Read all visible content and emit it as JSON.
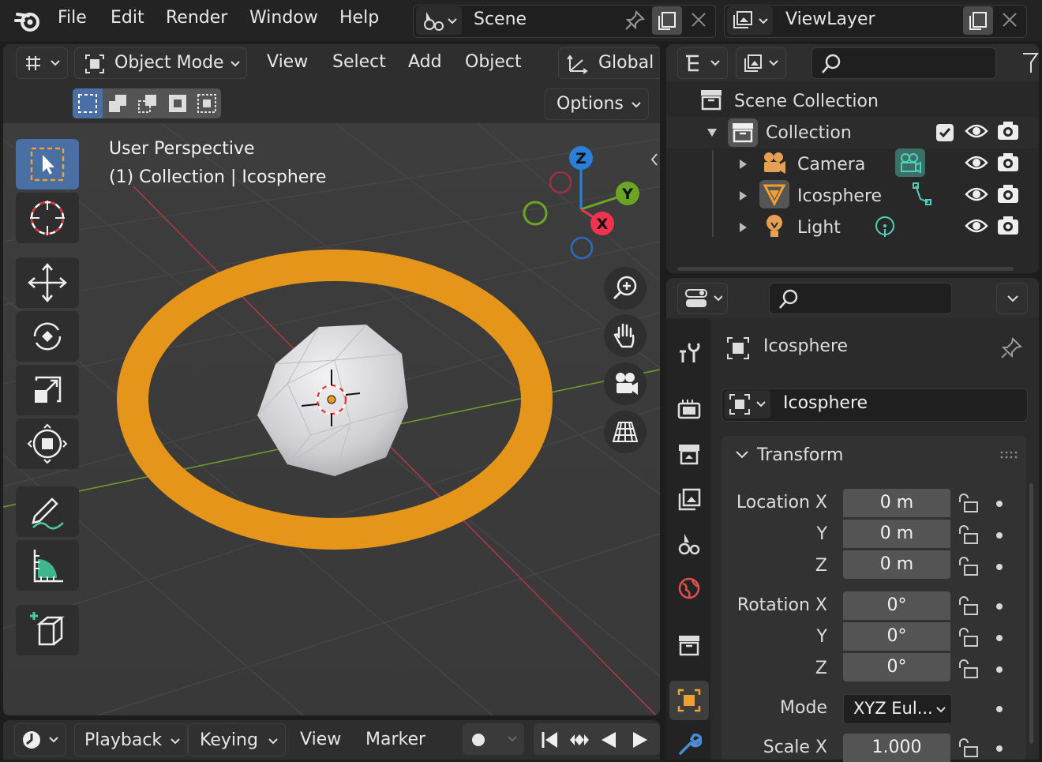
{
  "topbar": {
    "menu": [
      "File",
      "Edit",
      "Render",
      "Window",
      "Help"
    ],
    "scene_label": "Scene",
    "viewlayer_label": "ViewLayer"
  },
  "viewport_header": {
    "mode": "Object Mode",
    "menu": [
      "View",
      "Select",
      "Add",
      "Object"
    ],
    "orientation": "Global",
    "options": "Options"
  },
  "viewport_overlay": {
    "line1": "User Perspective",
    "line2": "(1) Collection | Icosphere"
  },
  "gizmo": {
    "z": "Z",
    "y": "Y",
    "x": "X"
  },
  "outliner": {
    "scene_collection": "Scene Collection",
    "collection": "Collection",
    "items": [
      "Camera",
      "Icosphere",
      "Light"
    ]
  },
  "properties": {
    "object_name": "Icosphere",
    "datablock_name": "Icosphere",
    "panel_title": "Transform",
    "location_label": "Location X",
    "rotation_label": "Rotation X",
    "y_label": "Y",
    "z_label": "Z",
    "location": [
      "0 m",
      "0 m",
      "0 m"
    ],
    "rotation": [
      "0°",
      "0°",
      "0°"
    ],
    "mode_label": "Mode",
    "mode_value": "XYZ Eul...",
    "scale_label": "Scale X",
    "scale_x": "1.000"
  },
  "timeline": {
    "menu": [
      "Playback",
      "Keying",
      "View",
      "Marker"
    ]
  },
  "colors": {
    "accent": "#4a6fa5",
    "selection_orange": "#e5961a",
    "x_axis": "#f0344f",
    "y_axis": "#6ca524",
    "z_axis": "#2a7fdb"
  }
}
